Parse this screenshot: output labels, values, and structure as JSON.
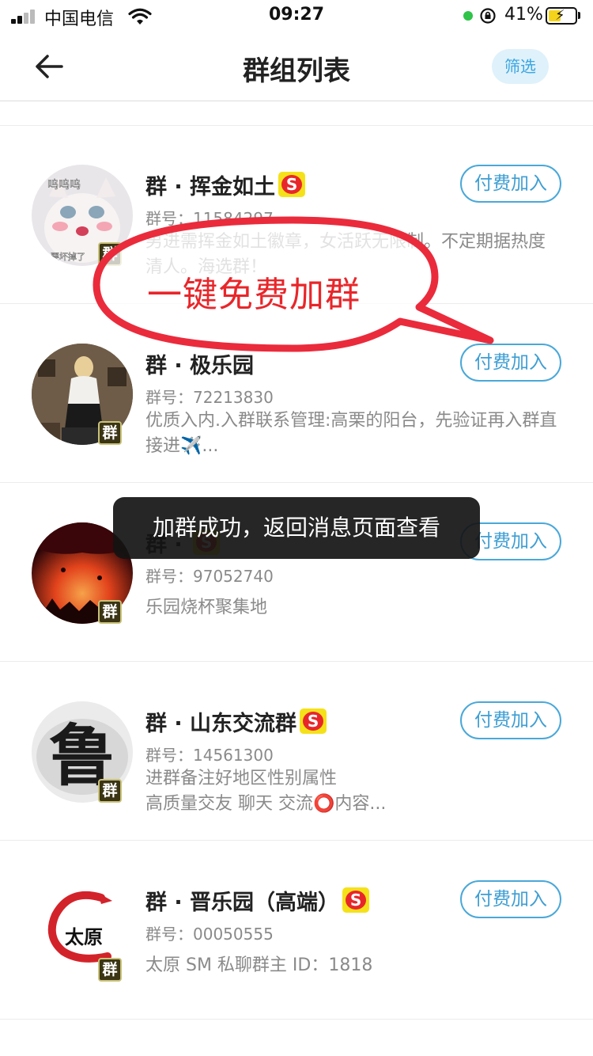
{
  "status_bar": {
    "carrier": "中国电信",
    "time": "09:27",
    "battery_percent": "41%",
    "battery_level": 0.41
  },
  "header": {
    "title": "群组列表",
    "filter_label": "筛选",
    "back_icon": "back-arrow-icon"
  },
  "groups": [
    {
      "name": "群 · 挥金如土",
      "has_s_badge": true,
      "id_label": "群号：11584297",
      "description": "男进需挥金如土徽章，女活跃无限制。不定期据热度清人。海选群！",
      "join_label": "付费加入",
      "tag": "群"
    },
    {
      "name": "群 · 极乐园",
      "has_s_badge": false,
      "id_label": "群号：72213830",
      "description": "优质入内.入群联系管理:高栗的阳台，先验证再入群直接进✈️...",
      "join_label": "付费加入",
      "tag": "群"
    },
    {
      "name": "群 · ",
      "has_s_badge": true,
      "id_label": "群号：97052740",
      "description": "乐园烧杯聚集地",
      "join_label": "付费加入",
      "tag": "群"
    },
    {
      "name": "群 · 山东交流群",
      "has_s_badge": true,
      "id_label": "群号：14561300",
      "description": "进群备注好地区性别属性\n高质量交友 聊天 交流⭕内容...",
      "join_label": "付费加入",
      "tag": "群"
    },
    {
      "name": "群 · 晋乐园（高端）",
      "has_s_badge": true,
      "id_label": "群号：00050555",
      "description": "太原 SM  私聊群主 ID：1818",
      "join_label": "付费加入",
      "tag": "群"
    }
  ],
  "s_badge_letter": "S",
  "avatar_texts": {
    "cat_caption_top": "呜呜呜",
    "cat_caption_bottom": "要坏掉了",
    "lu_char": "鲁",
    "taiyuan": "太原"
  },
  "overlay": {
    "bubble_text": "一键免费加群",
    "toast_text": "加群成功，返回消息页面查看"
  },
  "colors": {
    "accent_blue": "#3e9ed3",
    "bubble_red": "#e8262a",
    "badge_yellow": "#f5e11a"
  }
}
